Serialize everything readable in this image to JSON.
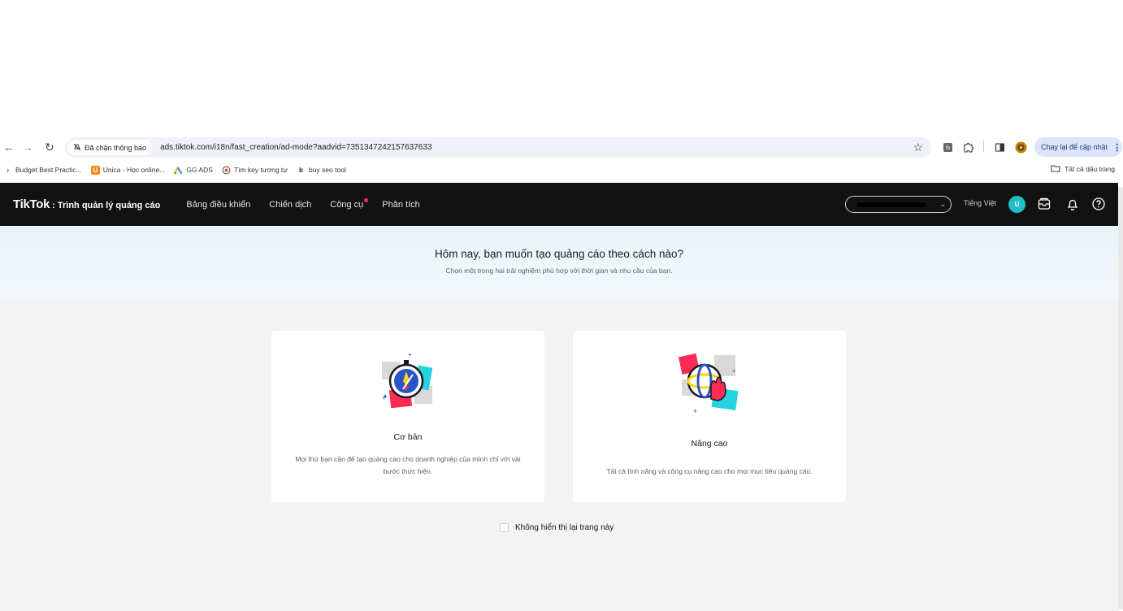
{
  "browser": {
    "blocked_notice": "Đã chặn thông báo",
    "url": "ads.tiktok.com/i18n/fast_creation/ad-mode?aadvid=7351347242157637633",
    "update_button": "Chạy lại để cập nhật",
    "bookmarks": [
      {
        "label": "Budget Best Practic...",
        "icon": "tiktok-icon"
      },
      {
        "label": "Unica - Học online...",
        "icon": "unica-icon"
      },
      {
        "label": "GG ADS",
        "icon": "google-ads-icon"
      },
      {
        "label": "Tìm key tương tự",
        "icon": "semrush-icon"
      },
      {
        "label": "buy seo tool",
        "icon": "b-icon"
      }
    ],
    "all_bookmarks": "Tất cả dấu trang"
  },
  "header": {
    "logo": "TikTok",
    "subtitle": ": Trình quản lý quảng cáo",
    "nav": [
      "Bảng điều khiển",
      "Chiến dịch",
      "Công cụ",
      "Phân tích"
    ],
    "language": "Tiếng Việt",
    "avatar_letter": "U",
    "accent_color": "#fe2c55",
    "avatar_color": "#20bec6"
  },
  "hero": {
    "title": "Hôm nay, bạn muốn tạo quảng cáo theo cách nào?",
    "subtitle": "Chọn một trong hai trải nghiệm phù hợp với thời gian và nhu cầu của bạn."
  },
  "options": [
    {
      "title": "Cơ bản",
      "description": "Mọi thứ bạn cần để tạo quảng cáo cho doanh nghiệp của mình chỉ với vài bước thực hiện.",
      "icon": "stopwatch-rocket-icon"
    },
    {
      "title": "Nâng cao",
      "description": "Tất cả tính năng và công cụ nâng cao cho mọi mục tiêu quảng cáo.",
      "icon": "globe-hand-icon"
    }
  ],
  "dont_show_again": "Không hiển thị lại trang này"
}
